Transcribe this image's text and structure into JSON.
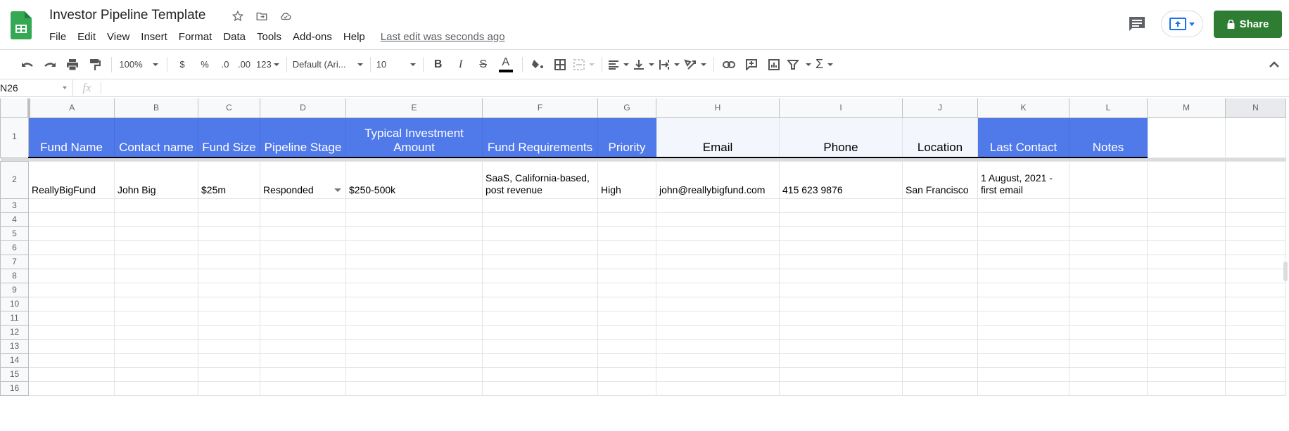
{
  "app": {
    "title": "Investor Pipeline Template",
    "last_edit": "Last edit was seconds ago",
    "share_label": "Share"
  },
  "menu": [
    "File",
    "Edit",
    "View",
    "Insert",
    "Format",
    "Data",
    "Tools",
    "Add-ons",
    "Help"
  ],
  "toolbar": {
    "zoom": "100%",
    "currency": "$",
    "percent": "%",
    "decrease_decimals": ".0",
    "increase_decimals": ".00",
    "more_formats": "123",
    "font": "Default (Ari...",
    "font_size": "10",
    "text_color": "#000000"
  },
  "formula_bar": {
    "name_box": "N26",
    "fx": "fx",
    "value": ""
  },
  "sheet": {
    "columns": [
      "A",
      "B",
      "C",
      "D",
      "E",
      "F",
      "G",
      "H",
      "I",
      "J",
      "K",
      "L",
      "M",
      "N"
    ],
    "selected_column": "N",
    "header_row": [
      "Fund Name",
      "Contact name",
      "Fund Size",
      "Pipeline Stage",
      "Typical Investment Amount",
      "Fund Requirements",
      "Priority",
      "Email",
      "Phone",
      "Location",
      "Last Contact",
      "Notes",
      "",
      ""
    ],
    "rows": [
      [
        "ReallyBigFund",
        "John Big",
        "$25m",
        "Responded",
        "$250-500k",
        "SaaS, California-based, post revenue",
        "High",
        "john@reallybigfund.com",
        "415 623 9876",
        "San Francisco",
        "1 August, 2021 - first email",
        "",
        "",
        ""
      ]
    ],
    "row_numbers": [
      "1",
      "2",
      "3",
      "4",
      "5",
      "6",
      "7",
      "8",
      "9",
      "10",
      "11",
      "12",
      "13",
      "14",
      "15",
      "16"
    ],
    "colors": {
      "header_blue": "#5079ea",
      "header_light": "#f3f6fd",
      "share_green": "#2e7d32"
    }
  }
}
